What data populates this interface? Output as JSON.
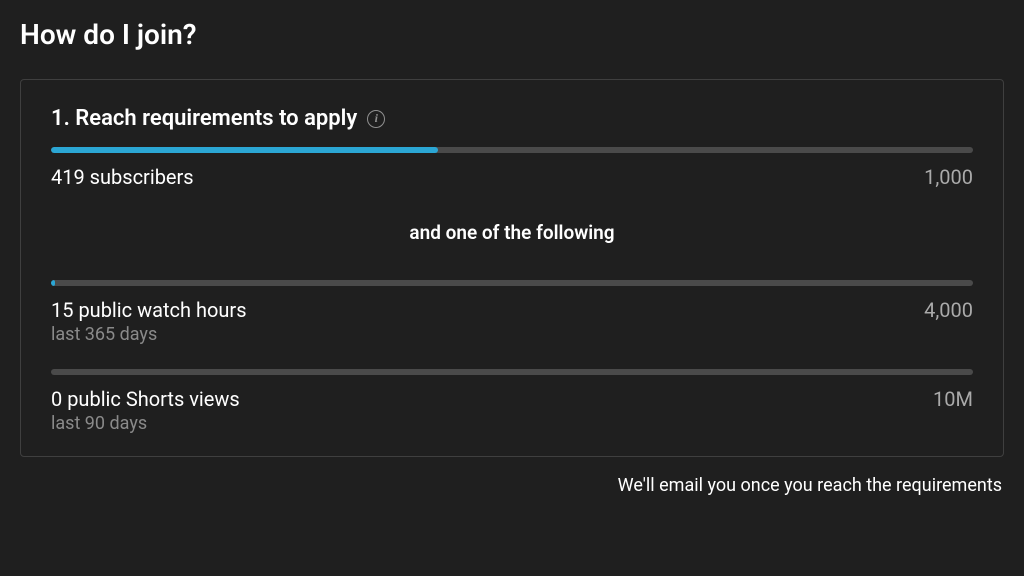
{
  "page_title": "How do I join?",
  "requirements": {
    "heading": "1. Reach requirements to apply",
    "info_icon": "i",
    "subscribers": {
      "current_label": "419 subscribers",
      "target_label": "1,000",
      "progress_pct": 42
    },
    "divider_label": "and one of the following",
    "watch_hours": {
      "current_label": "15 public watch hours",
      "period_label": "last 365 days",
      "target_label": "4,000",
      "progress_pct": 0.4
    },
    "shorts_views": {
      "current_label": "0 public Shorts views",
      "period_label": "last 90 days",
      "target_label": "10M",
      "progress_pct": 0
    }
  },
  "footer_note": "We'll email you once you reach the requirements",
  "colors": {
    "accent": "#2ba6d4",
    "bg": "#1f1f1f",
    "card_border": "#3f3f3f",
    "muted": "#8a8a8a"
  }
}
